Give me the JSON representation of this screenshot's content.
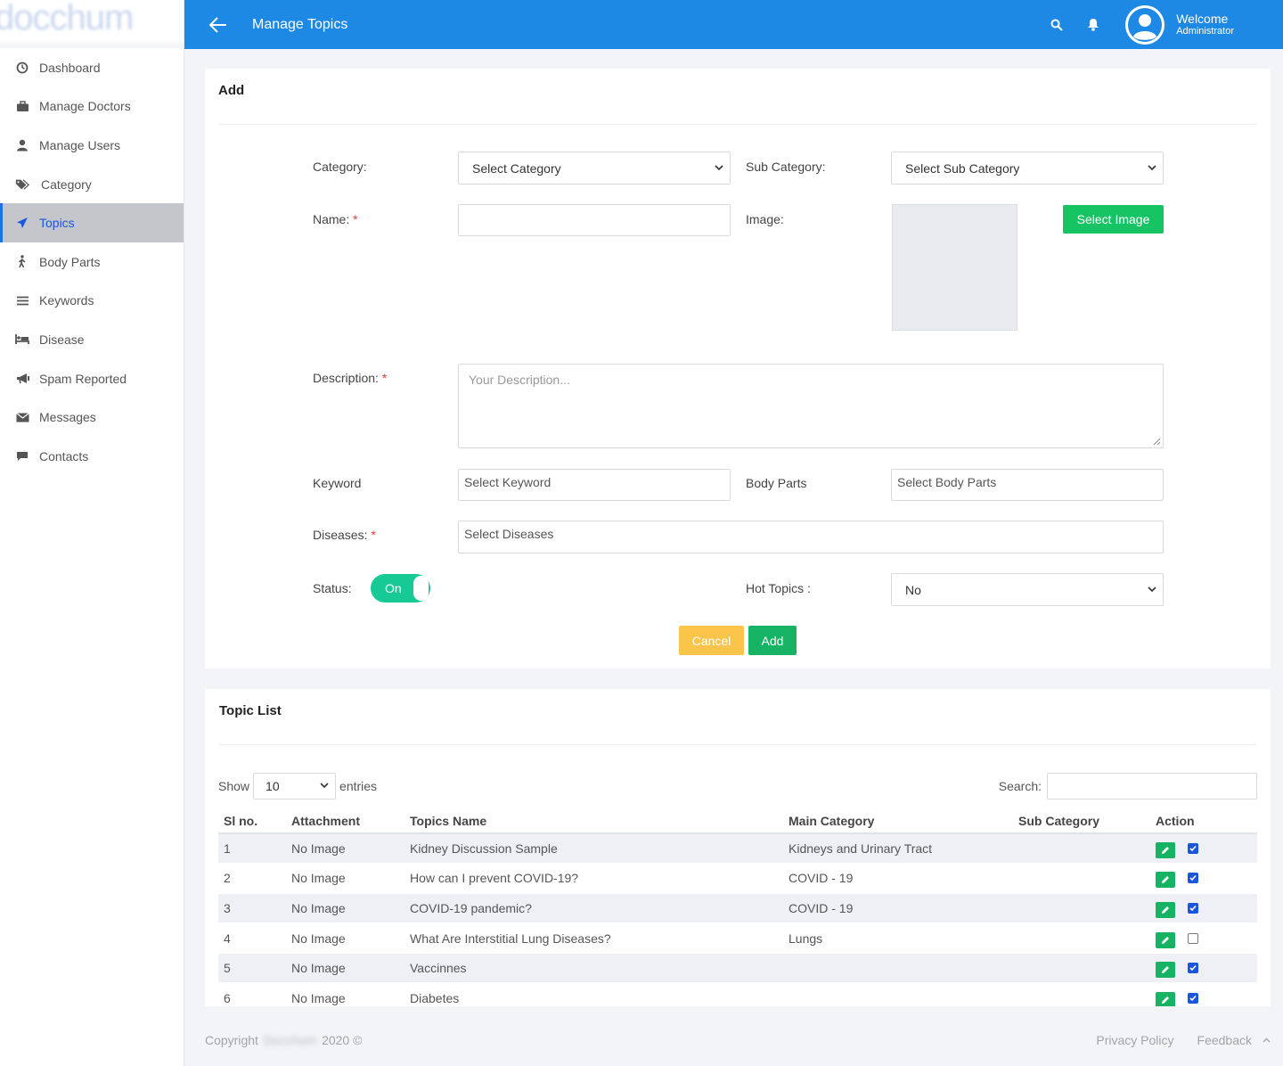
{
  "app": {
    "logo_text": "docchum"
  },
  "header": {
    "title": "Manage Topics",
    "welcome": "Welcome",
    "role": "Administrator"
  },
  "sidebar": {
    "items": [
      {
        "label": "Dashboard",
        "icon": "dashboard-icon"
      },
      {
        "label": "Manage Doctors",
        "icon": "briefcase-icon"
      },
      {
        "label": "Manage Users",
        "icon": "user-icon"
      },
      {
        "label": "Category",
        "icon": "tags-icon"
      },
      {
        "label": "Topics",
        "icon": "send-icon",
        "active": true
      },
      {
        "label": "Body Parts",
        "icon": "walking-icon"
      },
      {
        "label": "Keywords",
        "icon": "list-icon"
      },
      {
        "label": "Disease",
        "icon": "bed-icon"
      },
      {
        "label": "Spam Reported",
        "icon": "megaphone-icon"
      },
      {
        "label": "Messages",
        "icon": "envelope-icon"
      },
      {
        "label": "Contacts",
        "icon": "comment-icon"
      }
    ]
  },
  "form": {
    "title": "Add",
    "category_label": "Category:",
    "category_value": "Select Category",
    "subcategory_label": "Sub Category:",
    "subcategory_value": "Select Sub Category",
    "name_label": "Name:",
    "name_value": "",
    "image_label": "Image:",
    "select_image_button": "Select Image",
    "description_label": "Description:",
    "description_placeholder": "Your Description...",
    "keyword_label": "Keyword",
    "keyword_placeholder": "Select Keyword",
    "bodyparts_label": "Body Parts",
    "bodyparts_placeholder": "Select Body Parts",
    "diseases_label": "Diseases:",
    "diseases_placeholder": "Select Diseases",
    "status_label": "Status:",
    "status_value": "On",
    "hot_topics_label": "Hot Topics :",
    "hot_topics_value": "No",
    "required_mark": "*",
    "cancel_button": "Cancel",
    "add_button": "Add"
  },
  "list": {
    "title": "Topic List",
    "show_label": "Show",
    "entries_value": "10",
    "entries_label": "entries",
    "search_label": "Search:",
    "search_value": "",
    "columns": [
      "Sl no.",
      "Attachment",
      "Topics Name",
      "Main Category",
      "Sub Category",
      "Action"
    ],
    "rows": [
      {
        "sl": "1",
        "attachment": "No Image",
        "name": "Kidney Discussion Sample",
        "main": "Kidneys and Urinary Tract",
        "sub": "",
        "checked": true
      },
      {
        "sl": "2",
        "attachment": "No Image",
        "name": "How can I prevent COVID-19?",
        "main": "COVID - 19",
        "sub": "",
        "checked": true
      },
      {
        "sl": "3",
        "attachment": "No Image",
        "name": "COVID-19 pandemic?",
        "main": "COVID - 19",
        "sub": "",
        "checked": true
      },
      {
        "sl": "4",
        "attachment": "No Image",
        "name": "What Are Interstitial Lung Diseases?",
        "main": "Lungs",
        "sub": "",
        "checked": false
      },
      {
        "sl": "5",
        "attachment": "No Image",
        "name": "Vaccinnes",
        "main": "",
        "sub": "",
        "checked": true
      },
      {
        "sl": "6",
        "attachment": "No Image",
        "name": "Diabetes",
        "main": "",
        "sub": "",
        "checked": true
      }
    ]
  },
  "footer": {
    "copyright_prefix": "Copyright",
    "brand": "Docchum",
    "copyright_suffix": "2020 ©",
    "privacy": "Privacy Policy",
    "feedback": "Feedback"
  },
  "colors": {
    "header": "#1e88e5",
    "accent_green": "#16c995",
    "cancel": "#fbc54b",
    "active_nav": "#c4c6cc"
  }
}
